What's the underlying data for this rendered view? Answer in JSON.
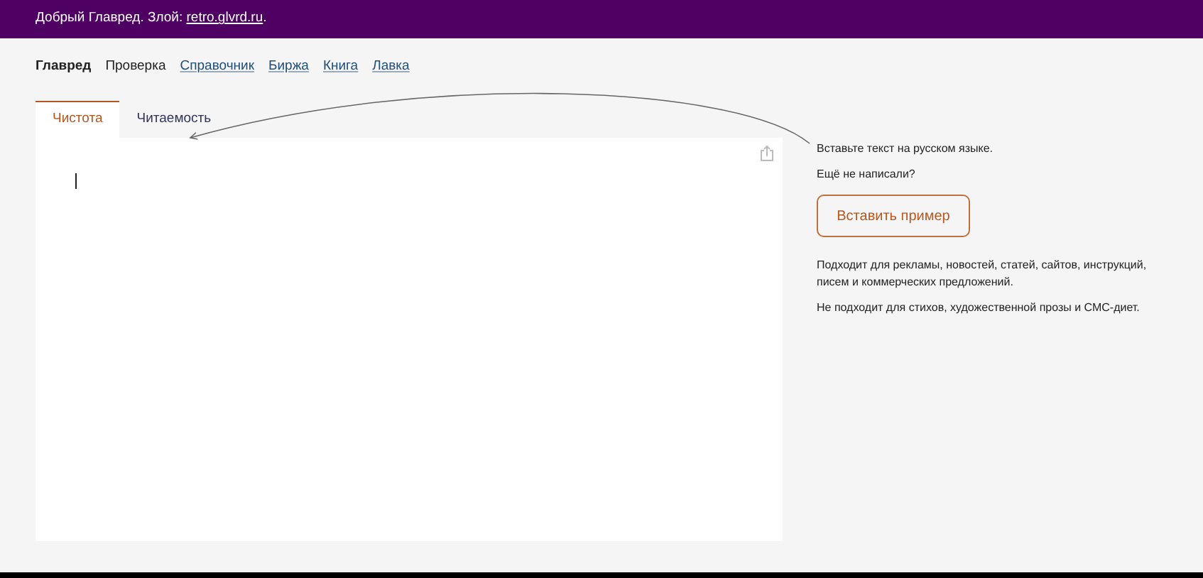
{
  "header": {
    "lead": "Добрый Главред. Злой: ",
    "link": "retro.glvrd.ru",
    "tail": "."
  },
  "nav": [
    {
      "label": "Главред",
      "kind": "current"
    },
    {
      "label": "Проверка",
      "kind": "text"
    },
    {
      "label": "Справочник",
      "kind": "link"
    },
    {
      "label": "Биржа",
      "kind": "link"
    },
    {
      "label": "Книга",
      "kind": "link"
    },
    {
      "label": "Лавка",
      "kind": "link"
    }
  ],
  "tabs": [
    {
      "label": "Чистота",
      "selected": true
    },
    {
      "label": "Читаемость",
      "selected": false
    }
  ],
  "side": {
    "hint": "Вставьте текст на русском языке.",
    "question": "Ещё не написали?",
    "button": "Вставить пример",
    "notes": [
      "Подходит для рекламы, новостей, статей, сайтов, инструкций, писем и коммерческих предложений.",
      "Не подходит для стихов, художественной прозы и СМС-диет."
    ]
  }
}
